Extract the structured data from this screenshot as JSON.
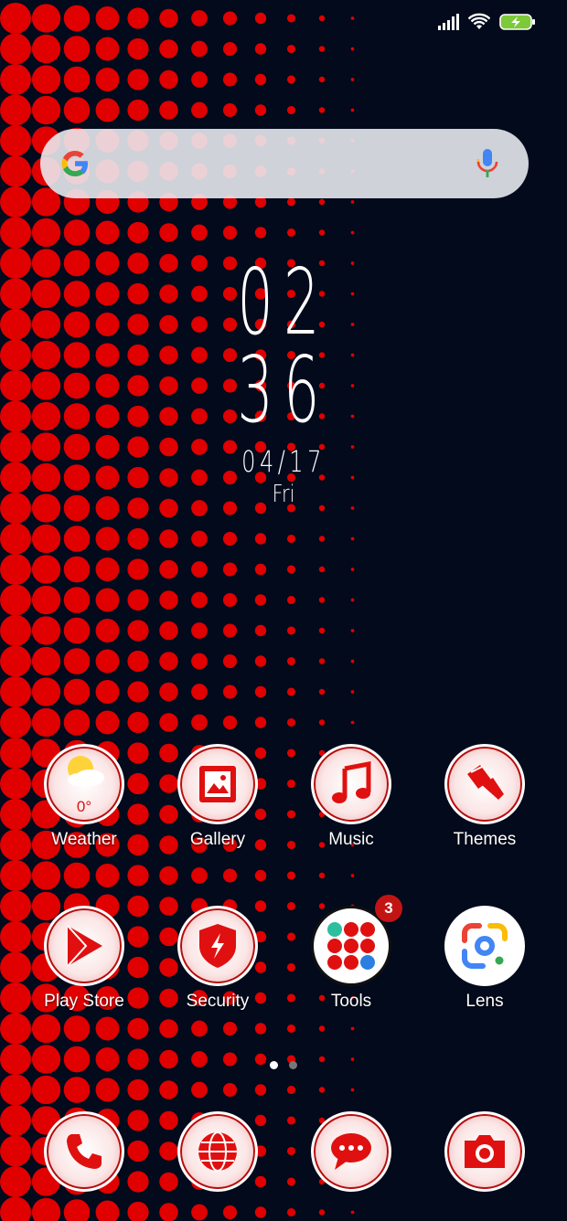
{
  "clock": {
    "hour": "02",
    "minute": "36",
    "date": "04/17",
    "day": "Fri"
  },
  "status": {
    "signal_icon": "signal-icon",
    "wifi_icon": "wifi-icon",
    "battery_icon": "battery-charging-icon"
  },
  "search": {
    "logo_icon": "google-g-icon",
    "mic_icon": "mic-icon"
  },
  "weather_temp": "0°",
  "apps_row1": [
    {
      "label": "Weather"
    },
    {
      "label": "Gallery"
    },
    {
      "label": "Music"
    },
    {
      "label": "Themes"
    }
  ],
  "apps_row2": [
    {
      "label": "Play Store"
    },
    {
      "label": "Security"
    },
    {
      "label": "Tools",
      "badge": "3"
    },
    {
      "label": "Lens"
    }
  ],
  "dock": [
    {
      "icon": "phone-icon"
    },
    {
      "icon": "browser-globe-icon"
    },
    {
      "icon": "messages-icon"
    },
    {
      "icon": "camera-icon"
    }
  ],
  "pager": {
    "pages": 2,
    "current": 1
  },
  "colors": {
    "background": "#020a1c",
    "accent": "#e00000"
  }
}
